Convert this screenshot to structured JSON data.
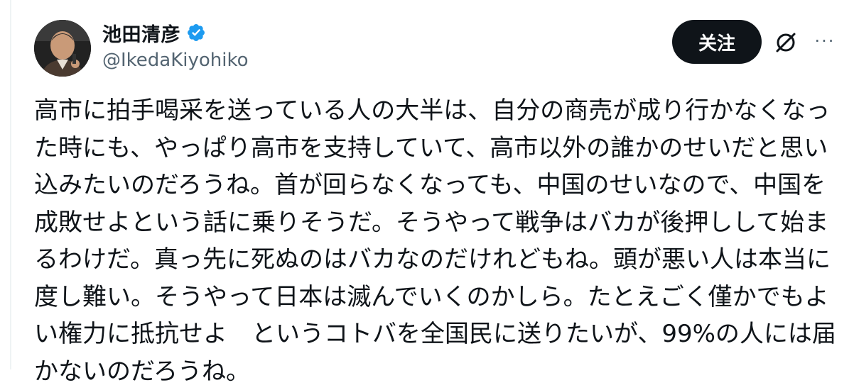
{
  "author": {
    "display_name": "池田清彦",
    "handle": "@IkedaKiyohiko",
    "verified": true
  },
  "actions": {
    "follow_label": "关注",
    "grok_icon": "grok-slash-circle-icon",
    "more_icon": "more-horizontal-icon",
    "more_glyph": "···"
  },
  "tweet": {
    "text": "高市に拍手喝采を送っている人の大半は、自分の商売が成り行かなくなっ\nた時にも、やっぱり高市を支持していて、高市以外の誰かのせいだと思い\n込みたいのだろうね。首が回らなくなっても、中国のせいなので、中国を\n成敗せよという話に乗りそうだ。そうやって戦争はバカが後押しして始ま\nるわけだ。真っ先に死ぬのはバカなのだけれどもね。頭が悪い人は本当に\n度し難い。そうやって日本は滅んでいくのかしら。たとえごく僅かでもよ\nい権力に抵抗せよ　というコトバを全国民に送りたいが、99%の人には届\nかないのだろうね。"
  },
  "colors": {
    "text": "#0f1419",
    "secondary": "#536471",
    "verified_blue": "#1d9bf0",
    "button_bg": "#0f1419"
  }
}
